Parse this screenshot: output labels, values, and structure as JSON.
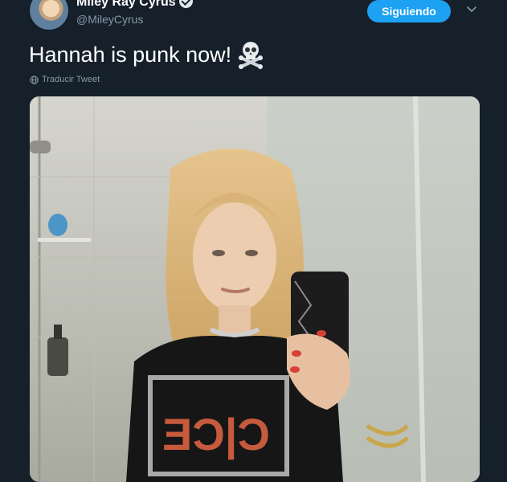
{
  "user": {
    "display_name": "Miley Ray Cyrus",
    "handle": "@MileyCyrus",
    "verified": true
  },
  "follow_button": {
    "label": "Siguiendo"
  },
  "tweet": {
    "text": "Hannah is punk now!",
    "emoji": "skull-and-crossbones-icon",
    "translate_label": "Traducir Tweet"
  },
  "colors": {
    "background": "#15202b",
    "accent": "#1da1f2",
    "secondary_text": "#8899a6"
  }
}
